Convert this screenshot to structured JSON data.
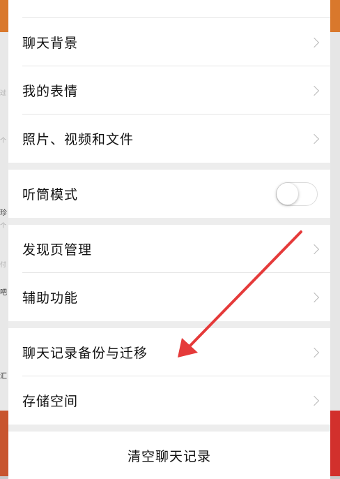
{
  "background_left": {
    "texts": [
      "过",
      "个",
      "珍",
      "个",
      "付",
      "吧",
      "汇"
    ],
    "colors": {
      "accent_top": "#d9782c",
      "accent_bottom": "#c8552e"
    }
  },
  "settings": {
    "items": [
      {
        "label": "聊天背景"
      },
      {
        "label": "我的表情"
      },
      {
        "label": "照片、视频和文件"
      },
      {
        "label": "听筒模式",
        "toggle": false
      },
      {
        "label": "发现页管理"
      },
      {
        "label": "辅助功能"
      },
      {
        "label": "聊天记录备份与迁移"
      },
      {
        "label": "存储空间"
      }
    ],
    "clear_label": "清空聊天记录"
  },
  "annotation": {
    "arrow_color": "#e53a3a",
    "points_to": "聊天记录备份与迁移"
  }
}
